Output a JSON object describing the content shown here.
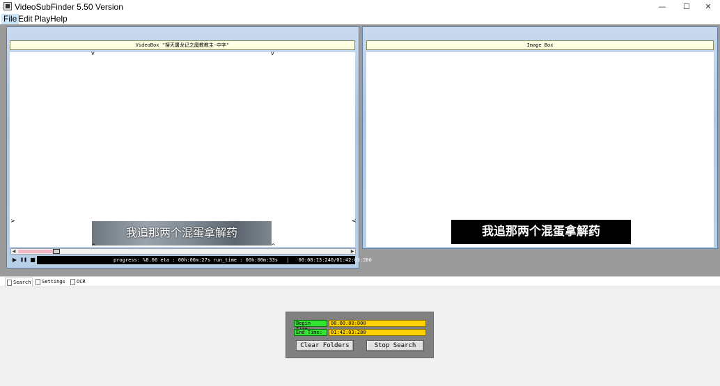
{
  "window": {
    "title": "VideoSubFinder 5.50 Version",
    "minimize_glyph": "—",
    "maximize_glyph": "☐",
    "close_glyph": "✕"
  },
  "menu": {
    "items": [
      "File",
      "Edit",
      "Play",
      "Help"
    ],
    "active_index": 0
  },
  "video_box": {
    "title": "VideoBox \"搜天屠龙记之魔教教主-中字\"",
    "subtitle_text": "我追那两个混蛋拿解药",
    "marker_down": "v",
    "marker_up": "^",
    "marker_right": ">",
    "marker_left": "<",
    "slider_left_arrow": "◀",
    "slider_right_arrow": "▶",
    "slider_position_fraction": 0.106,
    "play_glyph": "▶",
    "pause_glyph": "❚❚",
    "stop_glyph": "■",
    "status_text": "progress: %8.06 eta : 00h:06m:27s run_time : 00h:00m:33s   |   00:08:13:240/01:42:03:280"
  },
  "image_box": {
    "title": "Image Box",
    "subtitle_text": "我追那两个混蛋拿解药"
  },
  "tabs": [
    {
      "label": "Search",
      "active": true
    },
    {
      "label": "Settings",
      "active": false
    },
    {
      "label": "OCR",
      "active": false
    }
  ],
  "search": {
    "begin_label": "Begin Time:",
    "begin_value": "00:00:00:000",
    "end_label": "End Time:",
    "end_value": "01:42:03:280",
    "clear_button": "Clear Folders",
    "stop_button": "Stop Search"
  },
  "colors": {
    "workspace_bg": "#9b9b9b",
    "label_green": "#33e433",
    "input_yellow": "#ffd200",
    "status_bar_bg": "#000000",
    "progress_pink": "#f1b7c4"
  }
}
